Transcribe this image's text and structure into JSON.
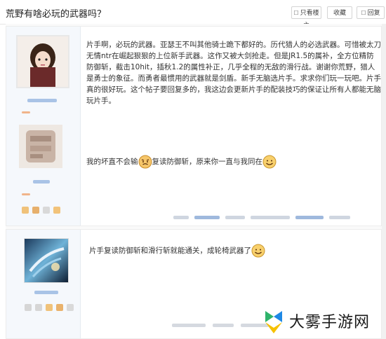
{
  "header": {
    "title": "荒野有啥必玩的武器吗？",
    "buttons": [
      {
        "label": "只看楼主",
        "icon": "user-filter-icon"
      },
      {
        "label": "收藏",
        "icon": "star-icon"
      },
      {
        "label": "回复",
        "icon": "reply-icon"
      }
    ]
  },
  "posts": [
    {
      "text": "片手啊，必玩的武器。亚瑟王不叫其他骑士跪下都好的。历代猎人的必选武器。可惜被太刀无情ntr在崛起狠狠的上位新手武器。这作又被大剑抢走。但是JR1.5的属补，全方位精防防御斩，截击10hit，插秋1.2的属性补正，几乎全程的无敌的滑行战。谢谢你荒野，猎人是勇士的象征。而勇者最惯用的武器就是剑盾。新手无脑选片手。求求你们玩一玩吧。片手真的很好玩。这个帖子要回复多的，我这边会更新片手的配装技巧的保证让所有人都能无脑玩片手。",
      "line2_a": "我的坏直不会输",
      "line2_b": "复读防御斩，原来你一直与我同在",
      "emoji_a": "angry-face-icon",
      "emoji_b": "smile-face-icon"
    },
    {
      "text": "片手复读防御斩和滑行斩就能通关，成轮椅武器了",
      "emoji": "smile-face-icon"
    }
  ],
  "watermark": {
    "text": "大雾手游网",
    "icon": "watermark-logo-icon"
  },
  "colors": {
    "accent_blue": "#2a7bd4",
    "logo_green": "#2fb36b",
    "logo_blue": "#1e88e5",
    "logo_yellow": "#f6c100"
  }
}
